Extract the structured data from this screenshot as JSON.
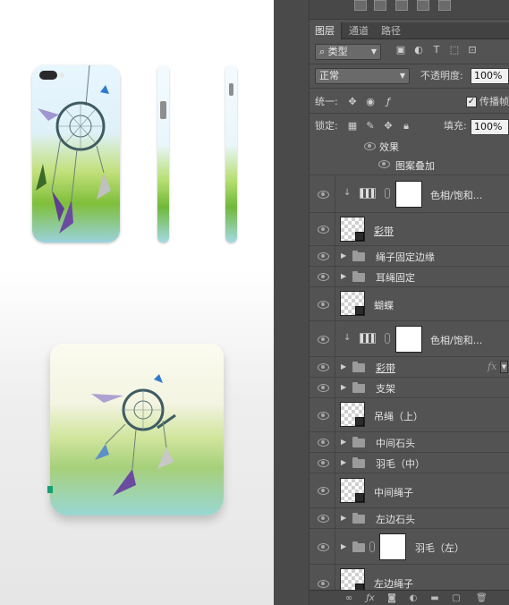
{
  "panel": {
    "tabs": [
      {
        "label": "图层",
        "active": true
      },
      {
        "label": "通道",
        "active": false
      },
      {
        "label": "路径",
        "active": false
      }
    ],
    "filter": {
      "kind_label": "类型"
    },
    "blend": {
      "mode": "正常",
      "opacity_label": "不透明度:",
      "opacity_value": "100%"
    },
    "unify": {
      "label": "统一:",
      "propagate_label": "传播帧",
      "propagate_checked": true
    },
    "lock": {
      "label": "锁定:",
      "fill_label": "填充:",
      "fill_value": "100%"
    },
    "layers": [
      {
        "type": "effects-label",
        "name": "效果"
      },
      {
        "type": "effect",
        "name": "图案叠加"
      },
      {
        "type": "adjustment",
        "name": "色相/饱和..."
      },
      {
        "type": "smart",
        "name": "彩带",
        "underline": true
      },
      {
        "type": "group",
        "name": "绳子固定边缘"
      },
      {
        "type": "group",
        "name": "耳绳固定"
      },
      {
        "type": "smart",
        "name": "蝴蝶"
      },
      {
        "type": "adjustment",
        "name": "色相/饱和..."
      },
      {
        "type": "group",
        "name": "彩带",
        "underline": true,
        "fx": "fx"
      },
      {
        "type": "group",
        "name": "支架"
      },
      {
        "type": "smart",
        "name": "吊绳（上）"
      },
      {
        "type": "group",
        "name": "中间石头"
      },
      {
        "type": "group",
        "name": "羽毛（中）"
      },
      {
        "type": "smart",
        "name": "中间绳子"
      },
      {
        "type": "group",
        "name": "左边石头"
      },
      {
        "type": "masked-group",
        "name": "羽毛（左）"
      },
      {
        "type": "smart",
        "name": "左边绳子"
      }
    ]
  },
  "colors": {
    "panel_bg": "#535353",
    "canvas_bg": "#ffffff"
  }
}
